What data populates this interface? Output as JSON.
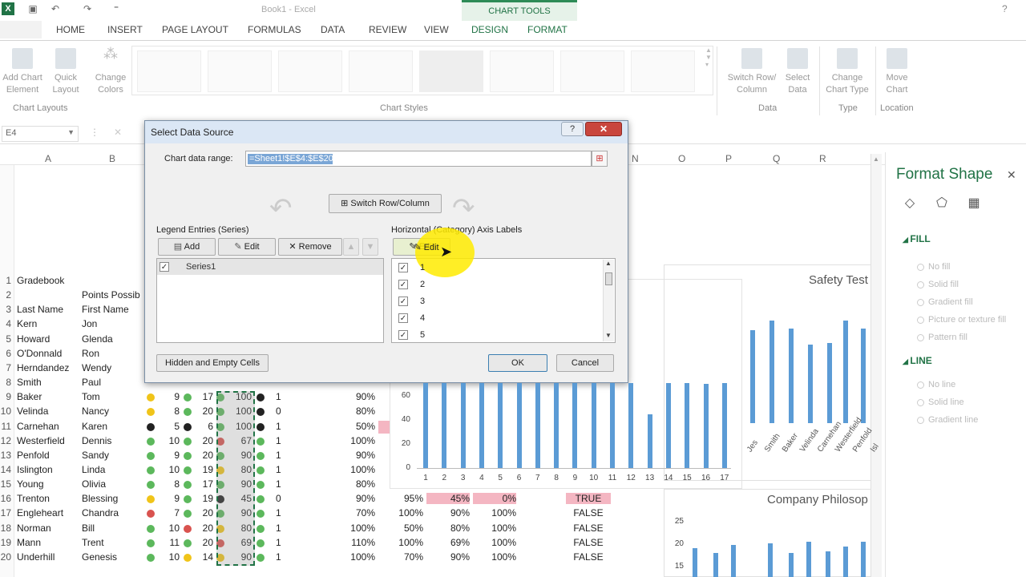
{
  "window": {
    "title": "Book1 - Excel",
    "contextual_tab_group": "CHART TOOLS",
    "help_glyph": "?"
  },
  "tabs": [
    "HOME",
    "INSERT",
    "PAGE LAYOUT",
    "FORMULAS",
    "DATA",
    "REVIEW",
    "VIEW",
    "DESIGN",
    "FORMAT"
  ],
  "ribbon": {
    "add_chart_element": "Add Chart Element",
    "quick_layout": "Quick Layout",
    "change_colors": "Change Colors",
    "switch_row_column": "Switch Row/ Column",
    "select_data": "Select Data",
    "change_chart_type": "Change Chart Type",
    "move_chart": "Move Chart",
    "groups": {
      "chart_layouts": "Chart Layouts",
      "chart_styles": "Chart Styles",
      "data": "Data",
      "type": "Type",
      "location": "Location"
    }
  },
  "formula_bar": {
    "name_box": "E4",
    "cancel_glyph": "✕"
  },
  "columns": [
    "A",
    "B",
    "N",
    "O",
    "P",
    "Q",
    "R"
  ],
  "rows": [
    {
      "n": "1",
      "a": "Gradebook",
      "b": ""
    },
    {
      "n": "2",
      "a": "",
      "b": "Points Possib"
    },
    {
      "n": "3",
      "a": "Last Name",
      "b": "First Name"
    },
    {
      "n": "4",
      "a": "Kern",
      "b": "Jon"
    },
    {
      "n": "5",
      "a": "Howard",
      "b": "Glenda"
    },
    {
      "n": "6",
      "a": "O'Donnald",
      "b": "Ron"
    },
    {
      "n": "7",
      "a": "Herndandez",
      "b": "Wendy"
    },
    {
      "n": "8",
      "a": "Smith",
      "b": "Paul"
    },
    {
      "n": "9",
      "a": "Baker",
      "b": "Tom"
    },
    {
      "n": "10",
      "a": "Velinda",
      "b": "Nancy"
    },
    {
      "n": "11",
      "a": "Carnehan",
      "b": "Karen"
    },
    {
      "n": "12",
      "a": "Westerfield",
      "b": "Dennis"
    },
    {
      "n": "13",
      "a": "Penfold",
      "b": "Sandy"
    },
    {
      "n": "14",
      "a": "Islington",
      "b": "Linda"
    },
    {
      "n": "15",
      "a": "Young",
      "b": "Olivia"
    },
    {
      "n": "16",
      "a": "Trenton",
      "b": "Blessing"
    },
    {
      "n": "17",
      "a": "Engleheart",
      "b": "Chandra"
    },
    {
      "n": "18",
      "a": "Norman",
      "b": "Bill"
    },
    {
      "n": "19",
      "a": "Mann",
      "b": "Trent"
    },
    {
      "n": "20",
      "a": "Underhill",
      "b": "Genesis"
    }
  ],
  "grid_rows": [
    {
      "c": "9",
      "d": "17",
      "e": "100",
      "f": "1",
      "g": "90%",
      "h": "",
      "i": "",
      "j": "",
      "k": ""
    },
    {
      "c": "8",
      "d": "20",
      "e": "100",
      "f": "0",
      "g": "80%",
      "h": "",
      "i": "",
      "j": "",
      "k": ""
    },
    {
      "c": "5",
      "d": "6",
      "e": "100",
      "f": "1",
      "g": "50%",
      "h": "",
      "i": "",
      "j": "",
      "k": ""
    },
    {
      "c": "10",
      "d": "20",
      "e": "67",
      "f": "1",
      "g": "100%",
      "h": "",
      "i": "",
      "j": "",
      "k": ""
    },
    {
      "c": "9",
      "d": "20",
      "e": "90",
      "f": "1",
      "g": "90%",
      "h": "",
      "i": "",
      "j": "",
      "k": ""
    },
    {
      "c": "10",
      "d": "19",
      "e": "80",
      "f": "1",
      "g": "100%",
      "h": "",
      "i": "",
      "j": "",
      "k": ""
    },
    {
      "c": "8",
      "d": "17",
      "e": "90",
      "f": "1",
      "g": "80%",
      "h": "",
      "i": "",
      "j": "",
      "k": ""
    },
    {
      "c": "9",
      "d": "19",
      "e": "45",
      "f": "0",
      "g": "90%",
      "h": "95%",
      "i": "45%",
      "j": "0%",
      "k": "TRUE"
    },
    {
      "c": "7",
      "d": "20",
      "e": "90",
      "f": "1",
      "g": "70%",
      "h": "100%",
      "i": "90%",
      "j": "100%",
      "k": "FALSE"
    },
    {
      "c": "10",
      "d": "20",
      "e": "80",
      "f": "1",
      "g": "100%",
      "h": "50%",
      "i": "80%",
      "j": "100%",
      "k": "FALSE"
    },
    {
      "c": "11",
      "d": "20",
      "e": "69",
      "f": "1",
      "g": "110%",
      "h": "100%",
      "i": "69%",
      "j": "100%",
      "k": "FALSE"
    },
    {
      "c": "10",
      "d": "14",
      "e": "90",
      "f": "1",
      "g": "100%",
      "h": "70%",
      "i": "90%",
      "j": "100%",
      "k": "FALSE"
    }
  ],
  "format_pane": {
    "title": "Format Shape",
    "close_glyph": "✕",
    "fill_section": "FILL",
    "fill_options": [
      "No fill",
      "Solid fill",
      "Gradient fill",
      "Picture or texture fill",
      "Pattern fill"
    ],
    "line_section": "LINE",
    "line_options": [
      "No line",
      "Solid line",
      "Gradient line"
    ]
  },
  "charts": {
    "right_title": "Safety Test",
    "right_labels": [
      "Jes",
      "Smith",
      "Baker",
      "Velinda",
      "Carnehan",
      "Westerfield",
      "Penfold",
      "Isl"
    ],
    "right2_title": "Company Philosop",
    "right2_ticks": [
      "25",
      "20",
      "15"
    ]
  },
  "chart_data": {
    "type": "bar",
    "categories": [
      "1",
      "2",
      "3",
      "4",
      "5",
      "6",
      "7",
      "8",
      "9",
      "10",
      "11",
      "12",
      "13",
      "14",
      "15",
      "16",
      "17"
    ],
    "values": [
      90,
      100,
      80,
      100,
      100,
      90,
      100,
      100,
      90,
      100,
      100,
      90,
      45,
      100,
      90,
      70,
      90
    ],
    "yticks": [
      "0",
      "20",
      "40",
      "60"
    ],
    "ylim": [
      0,
      100
    ]
  },
  "dialog": {
    "title": "Select Data Source",
    "help_glyph": "?",
    "close_glyph": "✕",
    "range_label": "Chart data range:",
    "range_value": "=Sheet1!$E$4:$E$20",
    "switch_button": "Switch Row/Column",
    "legend_label": "Legend Entries (Series)",
    "axis_label": "Horizontal (Category) Axis Labels",
    "add": "Add",
    "edit": "Edit",
    "remove": "Remove",
    "axis_edit": "Edit",
    "series": [
      "Series1"
    ],
    "axis_values": [
      "1",
      "2",
      "3",
      "4",
      "5"
    ],
    "hidden_cells": "Hidden and Empty Cells",
    "ok": "OK",
    "cancel": "Cancel"
  }
}
